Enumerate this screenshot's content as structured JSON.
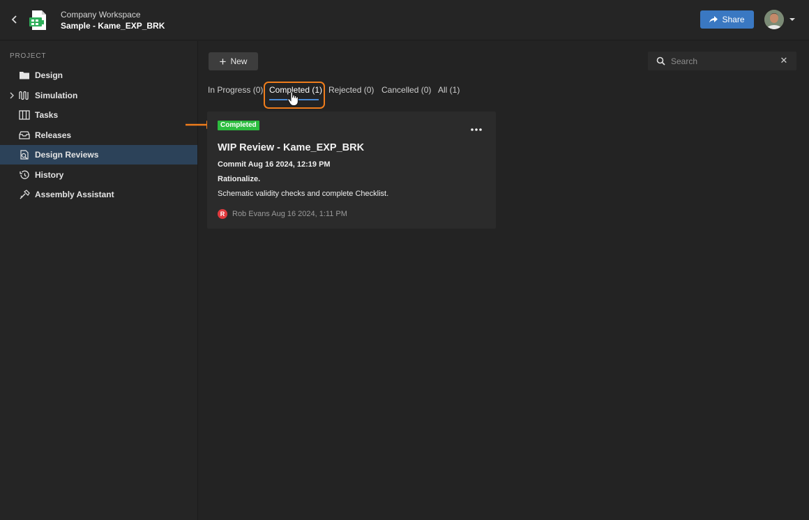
{
  "header": {
    "workspace": "Company Workspace",
    "project": "Sample - Kame_EXP_BRK",
    "share_label": "Share"
  },
  "sidebar": {
    "section_label": "PROJECT",
    "items": [
      {
        "label": "Design",
        "icon": "folder-icon"
      },
      {
        "label": "Simulation",
        "icon": "waveform-icon",
        "expandable": true
      },
      {
        "label": "Tasks",
        "icon": "kanban-icon"
      },
      {
        "label": "Releases",
        "icon": "package-icon"
      },
      {
        "label": "Design Reviews",
        "icon": "review-icon",
        "active": true
      },
      {
        "label": "History",
        "icon": "history-icon"
      },
      {
        "label": "Assembly Assistant",
        "icon": "assembly-icon"
      }
    ]
  },
  "toolbar": {
    "new_label": "New",
    "search_placeholder": "Search"
  },
  "tabs": [
    {
      "label": "In Progress (0)"
    },
    {
      "label": "Completed (1)",
      "active": true
    },
    {
      "label": "Rejected (0)"
    },
    {
      "label": "Cancelled (0)"
    },
    {
      "label": "All (1)"
    }
  ],
  "review": {
    "status": "Completed",
    "title": "WIP Review - Kame_EXP_BRK",
    "commit": "Commit Aug 16 2024, 12:19 PM",
    "line1": "Rationalize.",
    "line2": "Schematic validity checks and complete Checklist.",
    "author_initial": "R",
    "author_meta": "Rob Evans Aug 16 2024, 1:11 PM"
  },
  "colors": {
    "accent": "#3a78c2",
    "active_nav": "#2c4259",
    "badge_completed": "#2dbd3f",
    "annotation": "#ef7d1c",
    "tab_underline": "#4a8ad4"
  }
}
